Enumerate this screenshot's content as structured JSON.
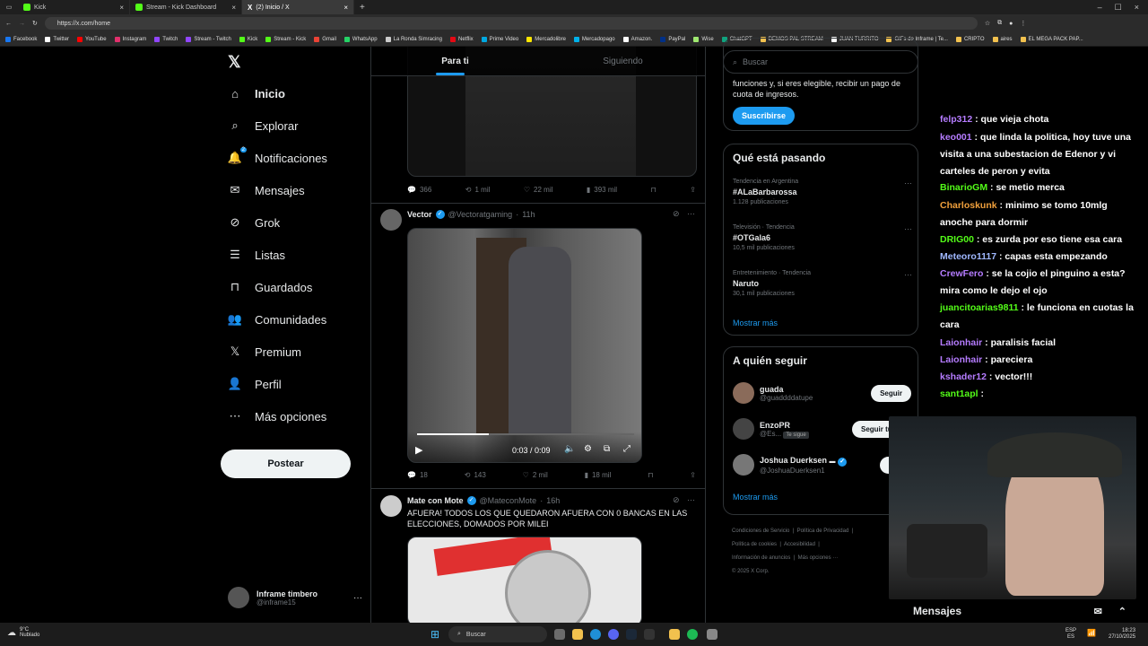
{
  "browser": {
    "tabs": [
      {
        "title": "Kick",
        "color": "#53fc18",
        "active": false
      },
      {
        "title": "Stream - Kick Dashboard",
        "color": "#53fc18",
        "active": false
      },
      {
        "title": "(2) Inicio / X",
        "color": "#ffffff",
        "active": true
      }
    ],
    "url": "https://x.com/home",
    "bookmarks": [
      "Facebook",
      "Twitter",
      "YouTube",
      "Instagram",
      "Twitch",
      "Stream - Twitch",
      "Kick",
      "Stream - Kick",
      "Gmail",
      "WhatsApp",
      "La Ronda Simracing",
      "Netflix",
      "Prime Video",
      "Mercadolibre",
      "Mercadopago",
      "Amazon.",
      "PayPal",
      "Wise",
      "ChatGPT",
      "DEMOS PAL STREAM",
      "JUAN TURRITO",
      "GIFs de Inframe | Te...",
      "CRIPTO",
      "aires",
      "EL MEGA PACK PAP..."
    ]
  },
  "nav": {
    "items": [
      {
        "label": "Inicio",
        "icon": "home-icon"
      },
      {
        "label": "Explorar",
        "icon": "search-icon"
      },
      {
        "label": "Notificaciones",
        "icon": "bell-icon",
        "badge": "2"
      },
      {
        "label": "Mensajes",
        "icon": "mail-icon"
      },
      {
        "label": "Grok",
        "icon": "grok-icon"
      },
      {
        "label": "Listas",
        "icon": "list-icon"
      },
      {
        "label": "Guardados",
        "icon": "bookmark-icon"
      },
      {
        "label": "Comunidades",
        "icon": "people-icon"
      },
      {
        "label": "Premium",
        "icon": "x-logo-icon"
      },
      {
        "label": "Perfil",
        "icon": "person-icon"
      },
      {
        "label": "Más opciones",
        "icon": "more-circle-icon"
      }
    ],
    "post_button": "Postear",
    "user": {
      "name": "Inframe timbero",
      "handle": "@inframe15"
    }
  },
  "feed": {
    "tabs": [
      "Para ti",
      "Siguiendo"
    ],
    "tweet1_stats": {
      "replies": "366",
      "retweets": "1 mil",
      "likes": "22 mil",
      "views": "393 mil"
    },
    "tweet2": {
      "name": "Vector",
      "handle": "@Vectoratgaming",
      "time": "11h",
      "video_time": "0:03 / 0:09",
      "stats": {
        "replies": "18",
        "retweets": "143",
        "likes": "2 mil",
        "views": "18 mil"
      }
    },
    "tweet3": {
      "name": "Mate con Mote",
      "handle": "@MateconMote",
      "time": "16h",
      "text": "AFUERA! TODOS LOS QUE QUEDARON AFUERA CON 0 BANCAS EN LAS ELECCIONES, DOMADOS POR MILEI"
    }
  },
  "sidebar": {
    "search_placeholder": "Buscar",
    "premium_text": "funciones y, si eres elegible, recibir un pago de cuota de ingresos.",
    "subscribe_button": "Suscribirse",
    "trends_title": "Qué está pasando",
    "trends": [
      {
        "meta": "Tendencia en Argentina",
        "name": "#ALaBarbarossa",
        "count": "1.128 publicaciones"
      },
      {
        "meta": "Televisión · Tendencia",
        "name": "#OTGala6",
        "count": "10,5 mil publicaciones"
      },
      {
        "meta": "Entretenimiento · Tendencia",
        "name": "Naruto",
        "count": "30,1 mil publicaciones"
      }
    ],
    "show_more": "Mostrar más",
    "who_title": "A quién seguir",
    "who": [
      {
        "name": "guada",
        "handle": "@guaddddatupe",
        "button": "Seguir"
      },
      {
        "name": "EnzoPR",
        "handle": "@Es...",
        "badge": "Te sigue",
        "button": "Seguir tú tamb"
      },
      {
        "name": "Joshua Duerksen",
        "handle": "@JoshuaDuerksen1",
        "button": "Seg"
      }
    ],
    "who_more": "Mostrar más",
    "footer": [
      "Condiciones de Servicio",
      "Política de Privacidad",
      "Política de cookies",
      "Accesibilidad",
      "Información de anuncios",
      "Más opciones ···",
      "© 2025 X Corp."
    ]
  },
  "chat": {
    "messages": [
      {
        "user": "felp312",
        "color": "#b57cff",
        "text": "que vieja chota"
      },
      {
        "user": "keo001",
        "color": "#b57cff",
        "text": "que linda la politica, hoy tuve una visita a una subestacion de Edenor y vi carteles de peron y evita"
      },
      {
        "user": "BinarioGM",
        "color": "#53fc18",
        "text": "se metio merca"
      },
      {
        "user": "Charloskunk",
        "color": "#f0a03c",
        "text": "minimo se tomo 10mlg anoche para dormir"
      },
      {
        "user": "DRIG00",
        "color": "#53fc18",
        "text": "es zurda por eso tiene esa cara"
      },
      {
        "user": "Meteoro1117",
        "color": "#a0b8ff",
        "text": "capas esta empezando"
      },
      {
        "user": "CrewFero",
        "color": "#b57cff",
        "text": "se la cojio el pinguino a esta? mira como le dejo el ojo"
      },
      {
        "user": "juancitoarias9811",
        "color": "#53fc18",
        "text": "le funciona en cuotas la cara"
      },
      {
        "user": "Laionhair",
        "color": "#b57cff",
        "text": "paralisis facial"
      },
      {
        "user": "Laionhair",
        "color": "#b57cff",
        "text": "pareciera"
      },
      {
        "user": "kshader12",
        "color": "#b57cff",
        "text": "vector!!!"
      },
      {
        "user": "sant1apl",
        "color": "#53fc18",
        "text": ""
      }
    ],
    "mensajes_label": "Mensajes"
  },
  "taskbar": {
    "weather_temp": "9°C",
    "weather_desc": "Nublado",
    "search": "Buscar",
    "lang": "ESP",
    "lang2": "ES",
    "time": "18:23",
    "date": "27/10/2025"
  }
}
